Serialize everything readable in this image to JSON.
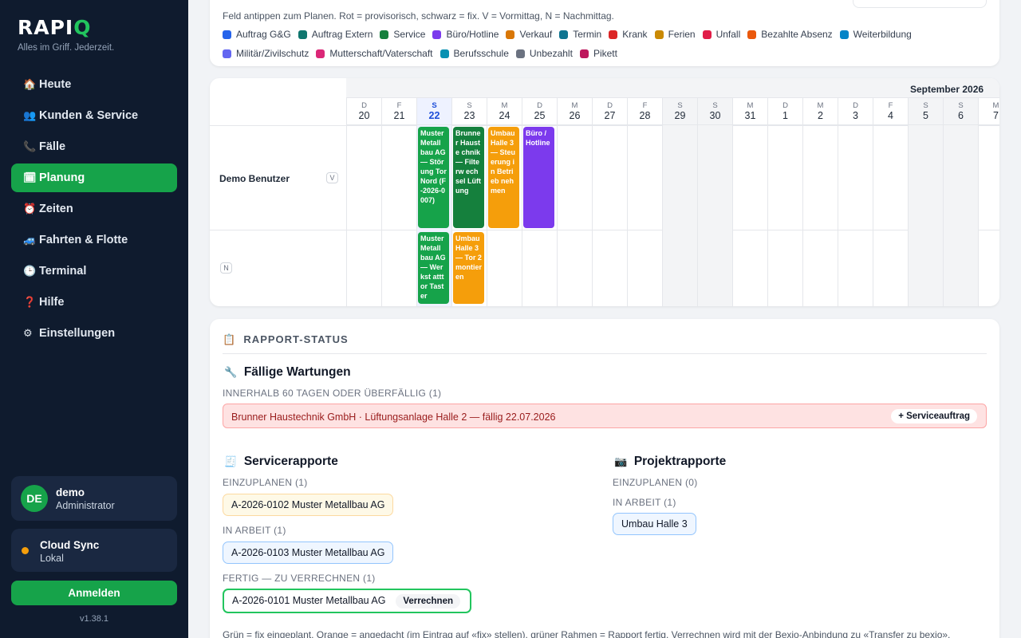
{
  "sidebar": {
    "logo_main": "RAPI",
    "logo_q": "Q",
    "tagline": "Alles im Griff. Jederzeit.",
    "nav": [
      {
        "label": "Heute",
        "icon": "🏠",
        "active": false
      },
      {
        "label": "Kunden & Service",
        "icon": "👥",
        "active": false
      },
      {
        "label": "Fälle",
        "icon": "📞",
        "active": false
      },
      {
        "label": "Planung",
        "icon": "🗓",
        "active": true
      },
      {
        "label": "Zeiten",
        "icon": "⏰",
        "active": false
      },
      {
        "label": "Fahrten & Flotte",
        "icon": "🚙",
        "active": false
      },
      {
        "label": "Terminal",
        "icon": "🕒",
        "active": false
      },
      {
        "label": "Hilfe",
        "icon": "❓",
        "active": false
      },
      {
        "label": "Einstellungen",
        "icon": "⚙",
        "active": false
      }
    ],
    "user": {
      "initials": "DE",
      "name": "demo",
      "role": "Administrator"
    },
    "sync": {
      "title": "Cloud Sync",
      "status": "Lokal",
      "color": "#f59e0b"
    },
    "login_label": "Anmelden",
    "version": "v1.38.1"
  },
  "legend": {
    "intro": "Feld antippen zum Planen. Rot = provisorisch, schwarz = fix. V = Vormittag, N = Nachmittag.",
    "row1": [
      {
        "label": "Auftrag G&G",
        "color": "#2563eb"
      },
      {
        "label": "Auftrag Extern",
        "color": "#0f766e"
      },
      {
        "label": "Service",
        "color": "#15803d"
      },
      {
        "label": "Büro/Hotline",
        "color": "#7c3aed"
      },
      {
        "label": "Verkauf",
        "color": "#d97706"
      },
      {
        "label": "Termin",
        "color": "#0e7490"
      },
      {
        "label": "Krank",
        "color": "#dc2626"
      },
      {
        "label": "Ferien",
        "color": "#ca8a04"
      },
      {
        "label": "Unfall",
        "color": "#e11d48"
      },
      {
        "label": "Bezahlte Absenz",
        "color": "#ea580c"
      },
      {
        "label": "Weiterbildung",
        "color": "#0284c7"
      }
    ],
    "row2": [
      {
        "label": "Militär/Zivilschutz",
        "color": "#6366f1"
      },
      {
        "label": "Mutterschaft/Vaterschaft",
        "color": "#db2777"
      },
      {
        "label": "Berufsschule",
        "color": "#0891b2"
      },
      {
        "label": "Unbezahlt",
        "color": "#6b7280"
      },
      {
        "label": "Pikett",
        "color": "#be185d"
      }
    ]
  },
  "planner": {
    "month_label": "September 2026",
    "resource": "Demo Benutzer",
    "slot_v": "V",
    "slot_n": "N",
    "days": [
      {
        "wd": "D",
        "num": "20"
      },
      {
        "wd": "F",
        "num": "21"
      },
      {
        "wd": "S",
        "num": "22",
        "today": true
      },
      {
        "wd": "S",
        "num": "23",
        "weekend": false
      },
      {
        "wd": "M",
        "num": "24"
      },
      {
        "wd": "D",
        "num": "25"
      },
      {
        "wd": "M",
        "num": "26"
      },
      {
        "wd": "D",
        "num": "27"
      },
      {
        "wd": "F",
        "num": "28"
      },
      {
        "wd": "S",
        "num": "29",
        "weekend": true
      },
      {
        "wd": "S",
        "num": "30",
        "weekend": true
      },
      {
        "wd": "M",
        "num": "31"
      },
      {
        "wd": "D",
        "num": "1"
      },
      {
        "wd": "M",
        "num": "2"
      },
      {
        "wd": "D",
        "num": "3"
      },
      {
        "wd": "F",
        "num": "4"
      },
      {
        "wd": "S",
        "num": "5",
        "weekend": true
      },
      {
        "wd": "S",
        "num": "6",
        "weekend": true
      },
      {
        "wd": "M",
        "num": "7"
      }
    ],
    "events": [
      {
        "day": 2,
        "slot": "V",
        "text": "Muster Metall bau AG — Störung Tor Nord (F-2026-0007)",
        "color": "#16a34a"
      },
      {
        "day": 3,
        "slot": "V",
        "text": "Brunner Hauste chnik — Filterw echsel Lüftung",
        "color": "#15803d"
      },
      {
        "day": 4,
        "slot": "V",
        "text": "Umbau Halle 3 — Steuerung in Betrieb nehmen",
        "color": "#f59e0b"
      },
      {
        "day": 5,
        "slot": "V",
        "text": "Büro / Hotline",
        "color": "#7c3aed"
      },
      {
        "day": 2,
        "slot": "N",
        "text": "Muster Metall bau AG — Werkst atttor Taster",
        "color": "#16a34a"
      },
      {
        "day": 3,
        "slot": "N",
        "text": "Umbau Halle 3 — Tor 2 montieren",
        "color": "#f59e0b"
      }
    ]
  },
  "rapport": {
    "title": "RAPPORT-STATUS",
    "title_icon": "📋",
    "wartungen": {
      "icon": "🔧",
      "heading": "Fällige Wartungen",
      "sub": "INNERHALB 60 TAGEN ODER ÜBERFÄLLIG (1)",
      "alert": "Brunner Haustechnik GmbH · Lüftungsanlage Halle 2 — fällig 22.07.2026",
      "button": "+ Serviceauftrag"
    },
    "service": {
      "icon": "🧾",
      "heading": "Servicerapporte",
      "einzuplanen": "EINZUPLANEN (1)",
      "einzuplanen_item": "A-2026-0102 Muster Metallbau AG",
      "in_arbeit": "IN ARBEIT (1)",
      "in_arbeit_item": "A-2026-0103 Muster Metallbau AG",
      "fertig": "FERTIG — ZU VERRECHNEN (1)",
      "fertig_item": "A-2026-0101 Muster Metallbau AG",
      "verrechnen": "Verrechnen"
    },
    "projekt": {
      "icon": "📷",
      "heading": "Projektrapporte",
      "einzuplanen": "EINZUPLANEN (0)",
      "in_arbeit": "IN ARBEIT (1)",
      "in_arbeit_item": "Umbau Halle 3"
    },
    "footnote": "Grün = fix eingeplant, Orange = angedacht (im Eintrag auf «fix» stellen), grüner Rahmen = Rapport fertig. Verrechnen wird mit der Bexio-Anbindung zu «Transfer zu bexio»."
  }
}
